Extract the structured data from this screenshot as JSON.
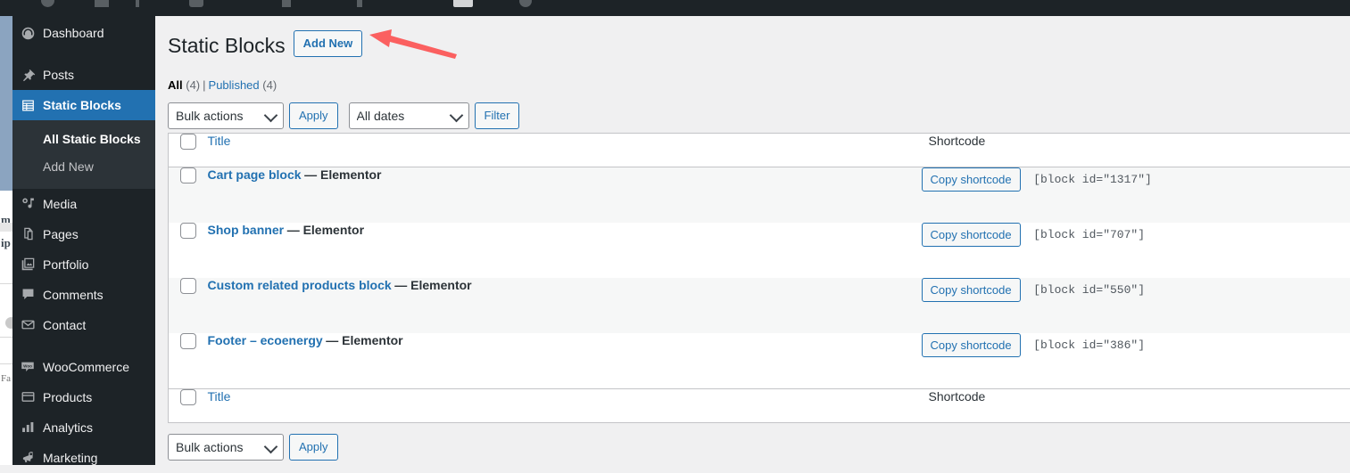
{
  "colors": {
    "wp_blue": "#2271b1",
    "menu_bg": "#1d2327",
    "submenu_bg": "#2c3338",
    "content_bg": "#f0f0f1",
    "annotation_red": "#fb6060"
  },
  "adminbar": {
    "icons": [
      "wordpress-logo-icon",
      "site-icon",
      "customize-icon",
      "comments-icon",
      "new-content-icon",
      "plugin-icon",
      "seo-icon",
      "cart-icon",
      "user-avatar-icon"
    ]
  },
  "behind_page": {
    "fragments": [
      "m",
      "ip",
      "Fa"
    ]
  },
  "sidebar": {
    "items": [
      {
        "label": "Dashboard",
        "icon": "dashboard-icon",
        "current": false,
        "sep_before": false
      },
      {
        "label": "Posts",
        "icon": "pin-icon",
        "current": false,
        "sep_before": true
      },
      {
        "label": "Static Blocks",
        "icon": "static-blocks-icon",
        "current": true,
        "sep_before": false
      },
      {
        "label": "Media",
        "icon": "media-icon",
        "current": false,
        "sep_before": false
      },
      {
        "label": "Pages",
        "icon": "pages-icon",
        "current": false,
        "sep_before": false
      },
      {
        "label": "Portfolio",
        "icon": "portfolio-icon",
        "current": false,
        "sep_before": false
      },
      {
        "label": "Comments",
        "icon": "comments-icon",
        "current": false,
        "sep_before": false
      },
      {
        "label": "Contact",
        "icon": "envelope-icon",
        "current": false,
        "sep_before": false
      },
      {
        "label": "WooCommerce",
        "icon": "woocommerce-icon",
        "current": false,
        "sep_before": true
      },
      {
        "label": "Products",
        "icon": "products-icon",
        "current": false,
        "sep_before": false
      },
      {
        "label": "Analytics",
        "icon": "analytics-icon",
        "current": false,
        "sep_before": false
      },
      {
        "label": "Marketing",
        "icon": "marketing-megaphone-icon",
        "current": false,
        "sep_before": false
      }
    ],
    "submenu": [
      {
        "label": "All Static Blocks",
        "current": true
      },
      {
        "label": "Add New",
        "current": false
      }
    ]
  },
  "header": {
    "title": "Static Blocks",
    "add_new_label": "Add New"
  },
  "views": {
    "all_label": "All",
    "all_count": "(4)",
    "separator": "|",
    "published_label": "Published",
    "published_count": "(4)"
  },
  "tablenav_top": {
    "bulk_actions_value": "Bulk actions",
    "apply_label": "Apply",
    "dates_value": "All dates",
    "filter_label": "Filter"
  },
  "tablenav_bottom": {
    "bulk_actions_value": "Bulk actions",
    "apply_label": "Apply"
  },
  "table": {
    "columns": {
      "title": "Title",
      "shortcode": "Shortcode"
    },
    "rows": [
      {
        "title": "Cart page block",
        "suffix": "— Elementor",
        "copy_label": "Copy shortcode",
        "shortcode": "[block id=\"1317\"]"
      },
      {
        "title": "Shop banner",
        "suffix": "— Elementor",
        "copy_label": "Copy shortcode",
        "shortcode": "[block id=\"707\"]"
      },
      {
        "title": "Custom related products block",
        "suffix": "— Elementor",
        "copy_label": "Copy shortcode",
        "shortcode": "[block id=\"550\"]"
      },
      {
        "title": "Footer – ecoenergy",
        "suffix": "— Elementor",
        "copy_label": "Copy shortcode",
        "shortcode": "[block id=\"386\"]"
      }
    ]
  },
  "annotation": {
    "type": "arrow",
    "points_to": "Add New button"
  }
}
